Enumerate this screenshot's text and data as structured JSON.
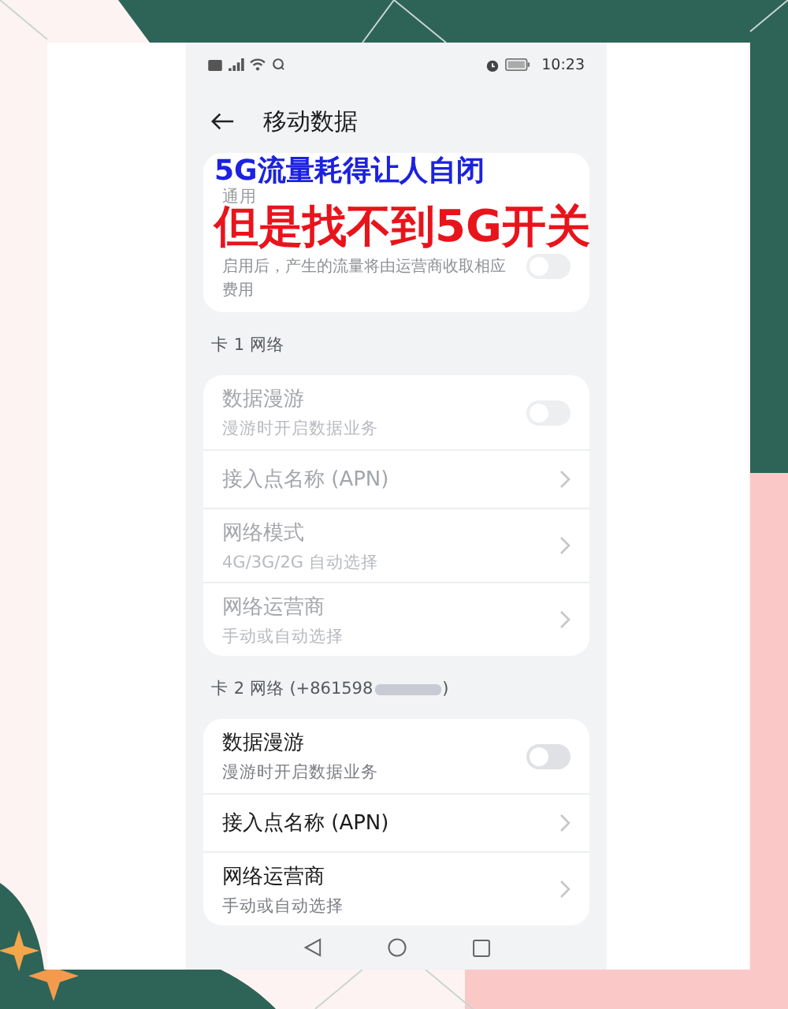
{
  "status_bar": {
    "time": "10:23"
  },
  "header": {
    "title": "移动数据"
  },
  "overlay": [
    {
      "text": "5G流量耗得让人自闭",
      "color": "#1c22e0"
    },
    {
      "text": "但是找不到5G开关",
      "color": "#e8141c"
    }
  ],
  "general_card": {
    "caption": "通用",
    "description": "启用后，产生的流量将由运营商收取相应费用",
    "on": false
  },
  "sections": [
    {
      "label": "卡 1 网络",
      "rows": [
        {
          "kind": "toggle",
          "title": "数据漫游",
          "subtitle": "漫游时开启数据业务",
          "on": false,
          "disabled": true
        },
        {
          "kind": "link",
          "title": "接入点名称 (APN)",
          "disabled": true
        },
        {
          "kind": "link",
          "title": "网络模式",
          "subtitle": "4G/3G/2G 自动选择",
          "disabled": true
        },
        {
          "kind": "link",
          "title": "网络运营商",
          "subtitle": "手动或自动选择",
          "disabled": true
        }
      ]
    },
    {
      "label": "卡 2 网络 (+861598",
      "label_end": ")",
      "rows": [
        {
          "kind": "toggle",
          "title": "数据漫游",
          "subtitle": "漫游时开启数据业务",
          "on": false,
          "disabled": false
        },
        {
          "kind": "link",
          "title": "接入点名称 (APN)",
          "disabled": false
        },
        {
          "kind": "link",
          "title": "网络运营商",
          "subtitle": "手动或自动选择",
          "disabled": false
        }
      ]
    }
  ]
}
